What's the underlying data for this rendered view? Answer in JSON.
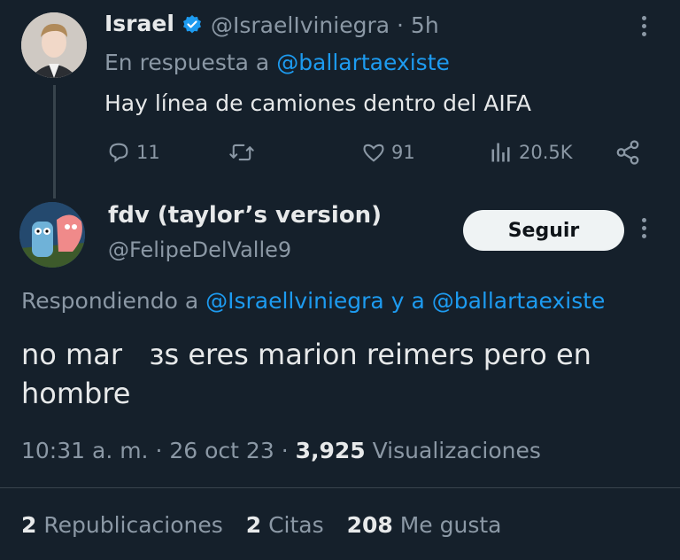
{
  "parent_tweet": {
    "author_name": "Israel",
    "handle": "@IsraelIviniegra",
    "time": "· 5h",
    "reply_prefix": "En respuesta a",
    "reply_to": "@ballartaexiste",
    "text": "Hay línea de camiones dentro del AIFA",
    "replies": "11",
    "likes": "91",
    "views": "20.5K",
    "icons": [
      "reply-icon",
      "retweet-icon",
      "like-icon",
      "views-icon",
      "share-icon",
      "verified-icon",
      "more-icon"
    ]
  },
  "tweet": {
    "author_name": "fdv (taylor’s version)",
    "handle": "@FelipeDelValle9",
    "follow_label": "Seguir",
    "reply_prefix": "Respondiendo a",
    "reply_to_1": "@Israellviniegra",
    "reply_conj": "y a",
    "reply_to_2": "@ballartaexiste",
    "text_line1": "no mar   ɜs eres marion reimers pero en",
    "text_line2": "hombre",
    "time": "10:31 a. m.",
    "date": "26 oct 23",
    "views_count": "3,925",
    "views_label": "Visualizaciones"
  },
  "stats": {
    "reposts_count": "2",
    "reposts_label": "Republicaciones",
    "quotes_count": "2",
    "quotes_label": "Citas",
    "likes_count": "208",
    "likes_label": "Me gusta"
  },
  "colors": {
    "background": "#15202b",
    "text": "#e7e9ea",
    "muted": "#8b98a5",
    "link": "#1d9bf0"
  }
}
